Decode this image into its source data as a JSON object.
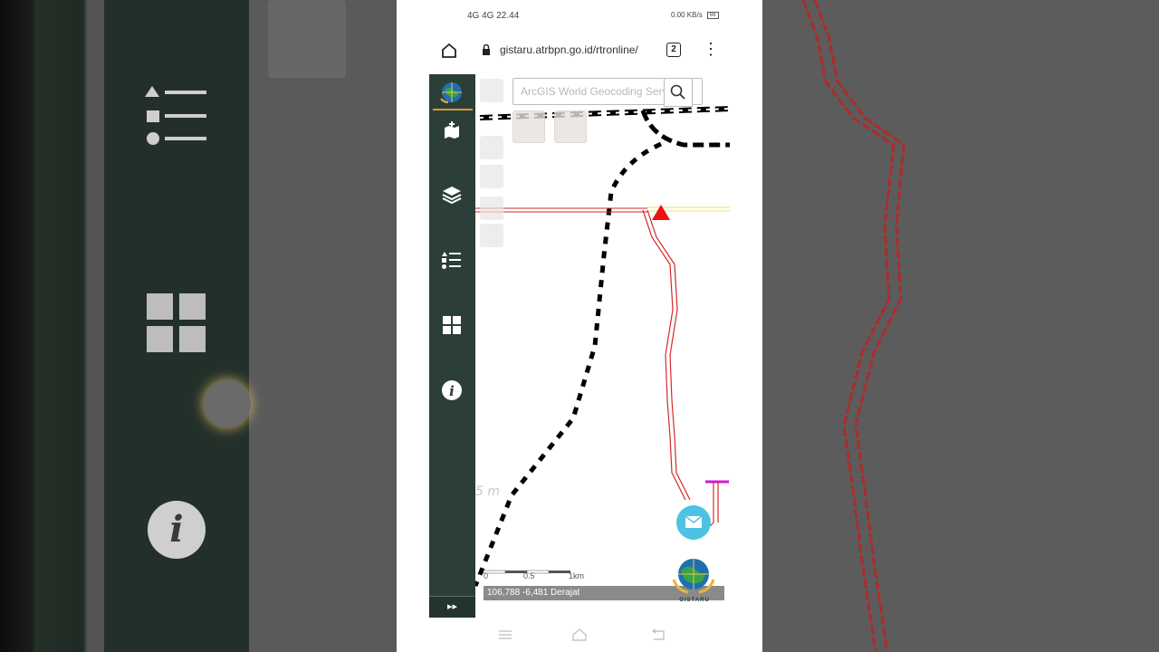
{
  "status_bar": {
    "left_text": "4G 4G 22.44",
    "right_text": "0.00 KB/s",
    "battery": "66"
  },
  "browser": {
    "url": "gistaru.atrbpn.go.id/rtronline/",
    "tab_count": "2"
  },
  "sidebar": {
    "items": [
      {
        "name": "sidebar-item-add-data",
        "icon": "map-add-icon"
      },
      {
        "name": "sidebar-item-layers",
        "icon": "layers-icon"
      },
      {
        "name": "sidebar-item-legend",
        "icon": "list-icon"
      },
      {
        "name": "sidebar-item-basemap",
        "icon": "grid-icon"
      },
      {
        "name": "sidebar-item-info",
        "icon": "info-icon"
      }
    ],
    "expand_label": "▸▸"
  },
  "map": {
    "search_placeholder": "ArcGIS World Geocoding Servi",
    "scale": {
      "zero": "0",
      "mid": "0.5",
      "end": "1km"
    },
    "coordinates": "106,788 -6,481 Derajat",
    "faded_label": "5 m",
    "logo_text": "GISTARU"
  },
  "colors": {
    "sidebar": "#2c3e38",
    "accent": "#d59a3a",
    "mail_button": "#4ec2e3",
    "river": "#d42a2a",
    "marker": "#ee1111"
  }
}
